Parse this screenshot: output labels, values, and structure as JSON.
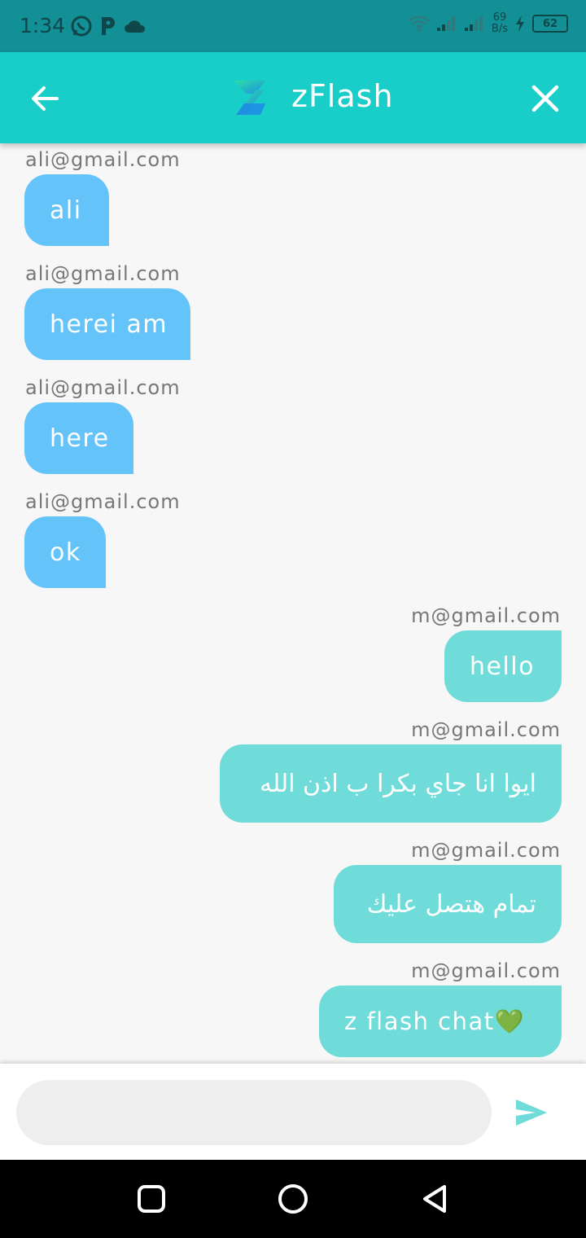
{
  "status_bar": {
    "time": "1:34",
    "net_speed_value": "69",
    "net_speed_unit": "B/s",
    "battery": "62"
  },
  "app_bar": {
    "title": "zFlash"
  },
  "messages": [
    {
      "side": "left",
      "sender": "ali@gmail.com",
      "text": "ali"
    },
    {
      "side": "left",
      "sender": "ali@gmail.com",
      "text": "herei am"
    },
    {
      "side": "left",
      "sender": "ali@gmail.com",
      "text": "here"
    },
    {
      "side": "left",
      "sender": "ali@gmail.com",
      "text": "ok"
    },
    {
      "side": "right",
      "sender": "m@gmail.com",
      "text": "hello"
    },
    {
      "side": "right",
      "sender": "m@gmail.com",
      "text": "ايوا انا جاي بكرا ب اذن الله"
    },
    {
      "side": "right",
      "sender": "m@gmail.com",
      "text": "تمام هتصل عليك"
    },
    {
      "side": "right",
      "sender": "m@gmail.com",
      "text": "z flash chat💚"
    }
  ],
  "composer": {
    "placeholder": "",
    "value": ""
  },
  "colors": {
    "status_bar": "#138f96",
    "app_bar": "#19cdc8",
    "left_bubble": "#64c4fa",
    "right_bubble": "#70dcd9",
    "send_icon": "#70dcd9"
  }
}
